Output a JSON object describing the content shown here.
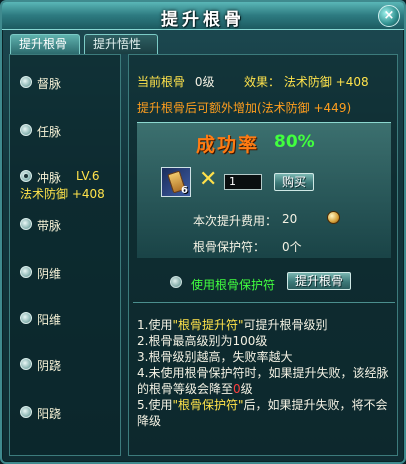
{
  "window": {
    "title": "提升根骨",
    "close": "×"
  },
  "tabs": [
    {
      "label": "提升根骨",
      "active": true
    },
    {
      "label": "提升悟性",
      "active": false
    }
  ],
  "left_list": [
    {
      "label": "督脉",
      "checked": false
    },
    {
      "label": "任脉",
      "checked": false
    },
    {
      "label": "冲脉",
      "checked": true,
      "level": "LV.6",
      "effect": "法术防御 +408"
    },
    {
      "label": "带脉",
      "checked": false
    },
    {
      "label": "阴维",
      "checked": false
    },
    {
      "label": "阳维",
      "checked": false
    },
    {
      "label": "阴跷",
      "checked": false
    },
    {
      "label": "阳跷",
      "checked": false
    }
  ],
  "info": {
    "current_label": "当前根骨",
    "current_value": "0级",
    "effect_label": "效果：",
    "effect_value": "法术防御 +408",
    "bonus_text": "提升根骨后可额外增加(法术防御 +449)"
  },
  "success": {
    "title": "成功率",
    "rate": "80%"
  },
  "purchase": {
    "item_count": "6",
    "times_symbol": "✕",
    "quantity": "1",
    "buy_label": "购买"
  },
  "cost": {
    "label": "本次提升费用：",
    "value": "20"
  },
  "protect": {
    "label": "根骨保护符：",
    "value": "0个",
    "use_label": "使用根骨保护符",
    "upgrade_label": "提升根骨"
  },
  "notes": {
    "n1_pre": "1.使用",
    "n1_hl": "\"根骨提升符\"",
    "n1_post": "可提升根骨级别",
    "n2": "2.根骨最高级别为100级",
    "n3": "3.根骨级别越高，失败率越大",
    "n4_a": "4.未使用根骨保护符时，如果提升失败，该经脉",
    "n4_b_pre": "的根骨等级会降至",
    "n4_b_red": "0",
    "n4_b_post": "级",
    "n5_pre": "5.使用",
    "n5_hl": "\"根骨保护符\"",
    "n5_post": "后，如果提升失败，将不会",
    "n5_c": "降级"
  }
}
